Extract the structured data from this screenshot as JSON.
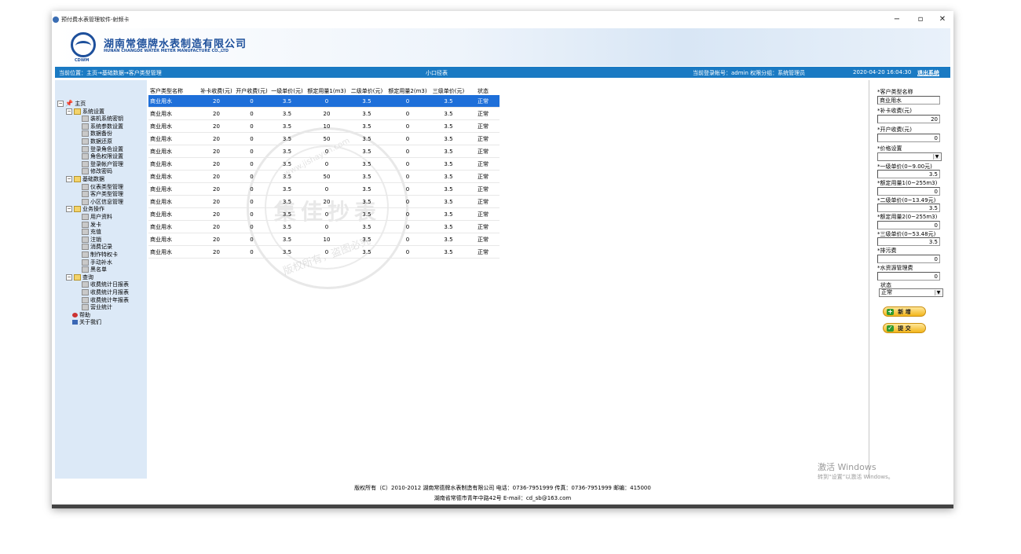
{
  "window": {
    "title": "预付费水表管理软件-射频卡",
    "controls": {
      "minimize": "−",
      "maximize": "▫",
      "close": "✕"
    }
  },
  "banner": {
    "company_cn": "湖南常德牌水表制造有限公司",
    "company_en": "HUNAN CHANGDE WATER METER MANUFACTURE CO.,LTD",
    "logo_text": "CDWM"
  },
  "navbar": {
    "location": "当前位置：主页→基础数据→客户类型管理",
    "center": "小口径表",
    "account": "当前登录帐号：admin  权限分组：系统管理员",
    "datetime": "2020-04-20 16:04:30",
    "logout": "退出系统"
  },
  "sidebar": {
    "root": "主页",
    "groups": [
      {
        "label": "系统设置",
        "items": [
          "装机系统密钥",
          "系统参数设置",
          "数据备份",
          "数据还原",
          "登录角色设置",
          "角色权限设置",
          "登录帐户管理",
          "修改密码"
        ]
      },
      {
        "label": "基础数据",
        "items": [
          "仪表类型管理",
          "客户类型管理",
          "小区信息管理"
        ]
      },
      {
        "label": "业务操作",
        "items": [
          "用户资料",
          "发卡",
          "充值",
          "注销",
          "消费记录",
          "制作特权卡",
          "手动补水",
          "黑名单"
        ]
      },
      {
        "label": "查询",
        "items": [
          "收费统计日报表",
          "收费统计月报表",
          "收费统计年报表",
          "营业统计"
        ]
      }
    ],
    "help": "帮助",
    "about": "关于我们"
  },
  "table": {
    "headers": [
      "客户类型名称",
      "补卡收费(元)",
      "开户收费(元)",
      "一级单价(元)",
      "额定用量1(m3)",
      "二级单价(元)",
      "额定用量2(m3)",
      "三级单价(元)",
      "状态"
    ],
    "rows": [
      [
        "商业用水",
        "20",
        "0",
        "3.5",
        "0",
        "3.5",
        "0",
        "3.5",
        "正常"
      ],
      [
        "商业用水",
        "20",
        "0",
        "3.5",
        "20",
        "3.5",
        "0",
        "3.5",
        "正常"
      ],
      [
        "商业用水",
        "20",
        "0",
        "3.5",
        "10",
        "3.5",
        "0",
        "3.5",
        "正常"
      ],
      [
        "商业用水",
        "20",
        "0",
        "3.5",
        "50",
        "3.5",
        "0",
        "3.5",
        "正常"
      ],
      [
        "商业用水",
        "20",
        "0",
        "3.5",
        "0",
        "3.5",
        "0",
        "3.5",
        "正常"
      ],
      [
        "商业用水",
        "20",
        "0",
        "3.5",
        "0",
        "3.5",
        "0",
        "3.5",
        "正常"
      ],
      [
        "商业用水",
        "20",
        "0",
        "3.5",
        "50",
        "3.5",
        "0",
        "3.5",
        "正常"
      ],
      [
        "商业用水",
        "20",
        "0",
        "3.5",
        "0",
        "3.5",
        "0",
        "3.5",
        "正常"
      ],
      [
        "商业用水",
        "20",
        "0",
        "3.5",
        "20",
        "3.5",
        "0",
        "3.5",
        "正常"
      ],
      [
        "商业用水",
        "20",
        "0",
        "3.5",
        "0",
        "3.5",
        "0",
        "3.5",
        "正常"
      ],
      [
        "商业用水",
        "20",
        "0",
        "3.5",
        "0",
        "3.5",
        "0",
        "3.5",
        "正常"
      ],
      [
        "商业用水",
        "20",
        "0",
        "3.5",
        "10",
        "3.5",
        "0",
        "3.5",
        "正常"
      ],
      [
        "商业用水",
        "20",
        "0",
        "3.5",
        "0",
        "3.5",
        "0",
        "3.5",
        "正常"
      ]
    ]
  },
  "form": {
    "type_name_label": "*客户类型名称",
    "type_name_value": "商业用水",
    "replace_fee_label": "*补卡收费(元)",
    "replace_fee_value": "20",
    "open_fee_label": "*开户收费(元)",
    "open_fee_value": "0",
    "price_setting_label": "*价格设置",
    "price_setting_value": "",
    "price1_label": "*一级单价(0~9.00元)",
    "price1_value": "3.5",
    "quota1_label": "*额定用量1(0~255m3)",
    "quota1_value": "0",
    "price2_label": "*二级单价(0~13.49元)",
    "price2_value": "3.5",
    "quota2_label": "*额定用量2(0~255m3)",
    "quota2_value": "0",
    "price3_label": "*三级单价(0~53.48元)",
    "price3_value": "3.5",
    "sewage_label": "*排污费",
    "sewage_value": "0",
    "water_mgmt_label": "*水资源管理费",
    "water_mgmt_value": "0",
    "status_label": "状态",
    "status_value": "正常",
    "add_button": "新 增",
    "submit_button": "提 交"
  },
  "footer": {
    "line1": "版权所有（C）2010-2012 湖南常德牌水表制造有限公司 电话：0736-7951999 传真：0736-7951999 邮编：415000",
    "line2": "湖南省常德市青年中路42号 E-mail：cd_sb@163.com"
  },
  "watermark": {
    "main": "集佳抄表",
    "url": "www.jishayun.com",
    "bottom": "版权所有，盗图必究"
  },
  "os_overlay": {
    "activate_title": "激活 Windows",
    "activate_sub": "转到“设置”以激活 Windows。"
  }
}
